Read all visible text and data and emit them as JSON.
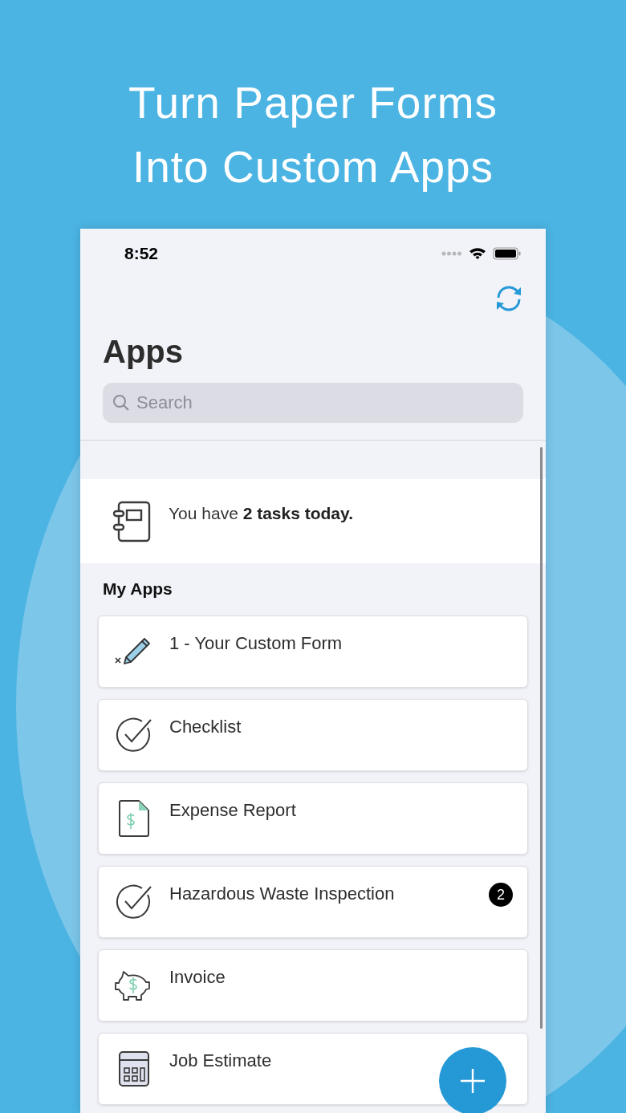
{
  "headline": [
    "Turn Paper Forms",
    "Into Custom Apps"
  ],
  "status_bar": {
    "time": "8:52"
  },
  "title": "Apps",
  "search": {
    "placeholder": "Search"
  },
  "tasks_banner": {
    "text": "You have **2 tasks today.**"
  },
  "section_title": "My Apps",
  "apps": [
    {
      "name": "1 - Your Custom Form",
      "kind": "pencil"
    },
    {
      "name": "Checklist",
      "kind": "check"
    },
    {
      "name": "Expense Report",
      "kind": "expense"
    },
    {
      "name": "Hazardous Waste Inspection",
      "kind": "check",
      "badge": "2"
    },
    {
      "name": "Invoice",
      "kind": "invoice"
    },
    {
      "name": "Job Estimate",
      "kind": "calculator"
    }
  ]
}
